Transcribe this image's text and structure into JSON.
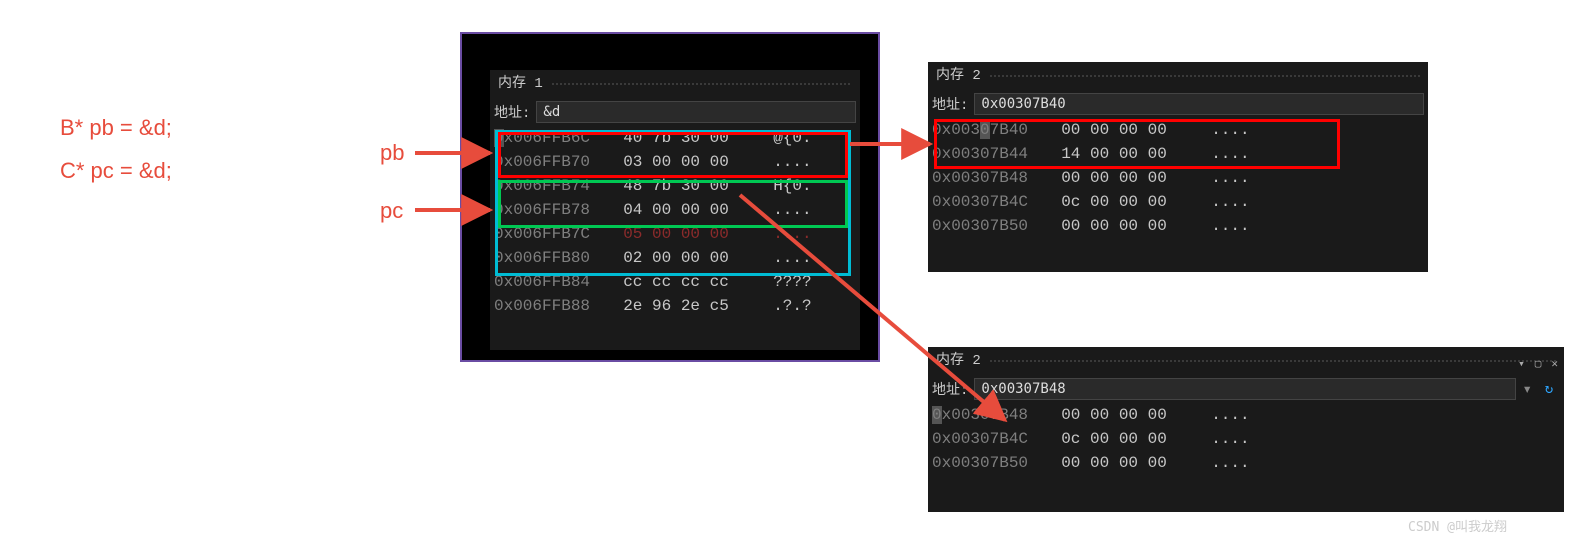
{
  "code": {
    "line1": "B* pb = &d;",
    "line2": "C* pc = &d;"
  },
  "labels": {
    "pb": "pb",
    "pc": "pc"
  },
  "panel1": {
    "title": "内存 1",
    "addr_label": "地址:",
    "addr_value": "&d",
    "rows": [
      {
        "addr": "0x006FFB6C",
        "bytes": "40 7b 30 00",
        "ascii": "@{0."
      },
      {
        "addr": "0x006FFB70",
        "bytes": "03 00 00 00",
        "ascii": "...."
      },
      {
        "addr": "0x006FFB74",
        "bytes": "48 7b 30 00",
        "ascii": "H{0."
      },
      {
        "addr": "0x006FFB78",
        "bytes": "04 00 00 00",
        "ascii": "...."
      },
      {
        "addr": "0x006FFB7C",
        "bytes": "05 00 00 00",
        "ascii": "...."
      },
      {
        "addr": "0x006FFB80",
        "bytes": "02 00 00 00",
        "ascii": "...."
      },
      {
        "addr": "0x006FFB84",
        "bytes": "cc cc cc cc",
        "ascii": "????"
      },
      {
        "addr": "0x006FFB88",
        "bytes": "2e 96 2e c5",
        "ascii": ".?.?"
      }
    ]
  },
  "panel2": {
    "title": "内存 2",
    "addr_label": "地址:",
    "addr_value": "0x00307B40",
    "rows": [
      {
        "addr": "0x00307B40",
        "bytes": "00 00 00 00",
        "ascii": "...."
      },
      {
        "addr": "0x00307B44",
        "bytes": "14 00 00 00",
        "ascii": "...."
      },
      {
        "addr": "0x00307B48",
        "bytes": "00 00 00 00",
        "ascii": "...."
      },
      {
        "addr": "0x00307B4C",
        "bytes": "0c 00 00 00",
        "ascii": "...."
      },
      {
        "addr": "0x00307B50",
        "bytes": "00 00 00 00",
        "ascii": "...."
      }
    ]
  },
  "panel3": {
    "title": "内存 2",
    "addr_label": "地址:",
    "addr_value": "0x00307B48",
    "rows": [
      {
        "addr": "0x00307B48",
        "bytes": "00 00 00 00",
        "ascii": "...."
      },
      {
        "addr": "0x00307B4C",
        "bytes": "0c 00 00 00",
        "ascii": "...."
      },
      {
        "addr": "0x00307B50",
        "bytes": "00 00 00 00",
        "ascii": "...."
      }
    ]
  },
  "colors": {
    "annotation_red": "#e74c3c",
    "box_blue": "#00bcd4",
    "box_red": "#ff0000",
    "box_green": "#00c853"
  },
  "watermark": "CSDN @叫我龙翔"
}
